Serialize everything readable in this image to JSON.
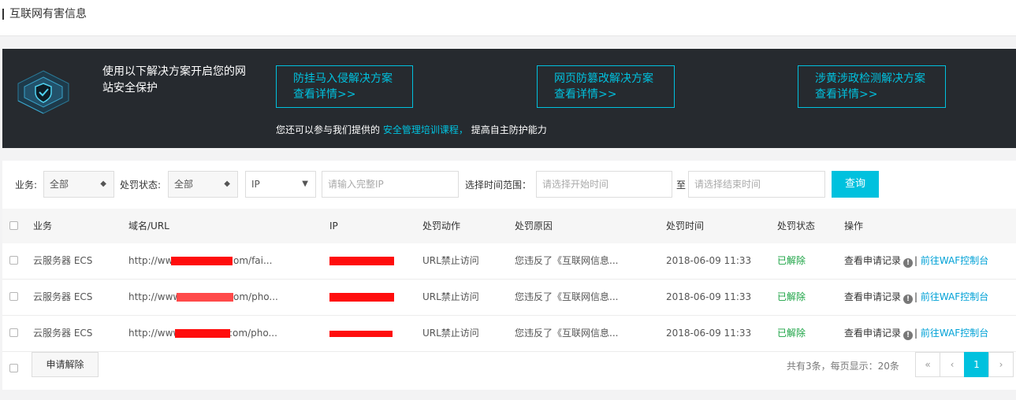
{
  "page": {
    "title": "互联网有害信息"
  },
  "banner": {
    "lead": "使用以下解决方案开启您的网站安全保护",
    "solutions": [
      {
        "name": "防挂马入侵解决方案",
        "detail": "查看详情>>"
      },
      {
        "name": "网页防篡改解决方案",
        "detail": "查看详情>>"
      },
      {
        "name": "涉黄涉政检测解决方案",
        "detail": "查看详情>>"
      }
    ],
    "note_prefix": "您还可以参与我们提供的",
    "note_link": "安全管理培训课程，",
    "note_suffix": "提高自主防护能力"
  },
  "filters": {
    "business_label": "业务:",
    "business_value": "全部",
    "status_label": "处罚状态:",
    "status_value": "全部",
    "ip_type_value": "IP",
    "ip_placeholder": "请输入完整IP",
    "time_label": "选择时间范围：",
    "start_placeholder": "请选择开始时间",
    "to_label": "至",
    "end_placeholder": "请选择结束时间",
    "query_label": "查询"
  },
  "table": {
    "columns": [
      "业务",
      "域名/URL",
      "IP",
      "处罚动作",
      "处罚原因",
      "处罚时间",
      "处罚状态",
      "操作"
    ],
    "rows": [
      {
        "business": "云服务器 ECS",
        "url_prefix": "http://www",
        "url_suffix": "om/fai...",
        "action": "URL禁止访问",
        "reason": "您违反了《互联网信息...",
        "time": "2018-06-09 11:33",
        "status": "已解除",
        "op_view": "查看申请记录",
        "op_link": "前往WAF控制台"
      },
      {
        "business": "云服务器 ECS",
        "url_prefix": "http://www.",
        "url_suffix": "om/pho...",
        "action": "URL禁止访问",
        "reason": "您违反了《互联网信息...",
        "time": "2018-06-09 11:33",
        "status": "已解除",
        "op_view": "查看申请记录",
        "op_link": "前往WAF控制台"
      },
      {
        "business": "云服务器 ECS",
        "url_prefix": "http://www.",
        "url_suffix": ":om/pho...",
        "action": "URL禁止访问",
        "reason": "您违反了《互联网信息...",
        "time": "2018-06-09 11:33",
        "status": "已解除",
        "op_view": "查看申请记录",
        "op_link": "前往WAF控制台"
      }
    ]
  },
  "footer": {
    "apply_label": "申请解除",
    "total_text": "共有3条，每页显示：20条",
    "pager": {
      "first": "«",
      "prev": "‹",
      "current": "1",
      "next": "›"
    }
  },
  "colors": {
    "accent": "#00c1de",
    "banner_bg": "#262a2f",
    "status_ok": "#1ba344",
    "redaction": "#ff0d0d"
  }
}
